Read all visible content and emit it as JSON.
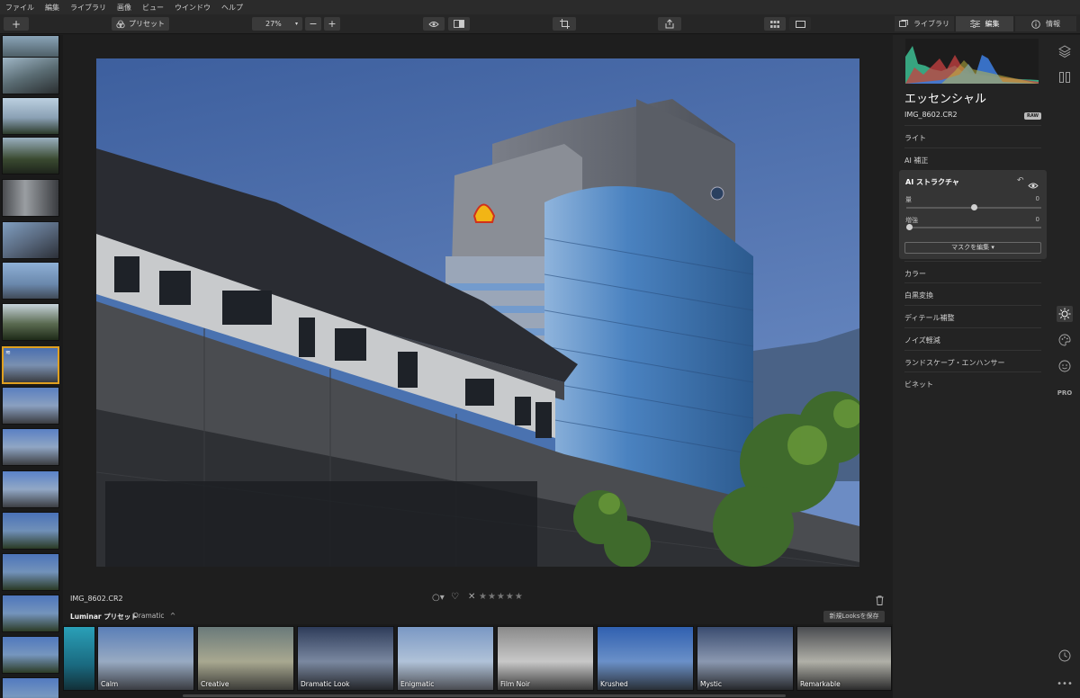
{
  "menu": [
    "ファイル",
    "編集",
    "ライブラリ",
    "画像",
    "ビュー",
    "ウインドウ",
    "ヘルプ"
  ],
  "toolbar": {
    "add_label": "+",
    "presets_label": "プリセット",
    "zoom_value": "27%",
    "zoom_minus": "−",
    "zoom_plus": "+"
  },
  "tabs": {
    "library": "ライブラリ",
    "edit": "編集",
    "info": "情報"
  },
  "right_panel": {
    "title": "エッセンシャル",
    "filename": "IMG_8602.CR2",
    "raw_badge": "RAW",
    "sections_top": [
      "ライト",
      "AI 補正"
    ],
    "card": {
      "title": "AI ストラクチャ",
      "slider1_label": "量",
      "slider1_value": "0",
      "slider1_level": 0.5,
      "slider2_label": "増強",
      "slider2_value": "0",
      "slider2_level": 0.0,
      "mask_button": "マスクを編集 ▾"
    },
    "sections_bottom": [
      "カラー",
      "白黒変換",
      "ディテール補整",
      "ノイズ軽減",
      "ランドスケープ・エンハンサー",
      "ビネット"
    ]
  },
  "rail": {
    "pro_label": "PRO"
  },
  "bottom": {
    "filename": "IMG_8602.CR2",
    "preset_group_label": "Luminar プリセット",
    "preset_category": "Dramatic",
    "save_looks_button": "新規Looksを保存",
    "stars": "★★★★★",
    "looks": [
      "Calm",
      "Creative",
      "Dramatic Look",
      "Enigmatic",
      "Film Noir",
      "Krushed",
      "Mystic",
      "Remarkable"
    ]
  },
  "colors": {
    "accent_selected": "#e0a020",
    "sky": "#4a6fb0",
    "panel_bg": "#232323"
  }
}
